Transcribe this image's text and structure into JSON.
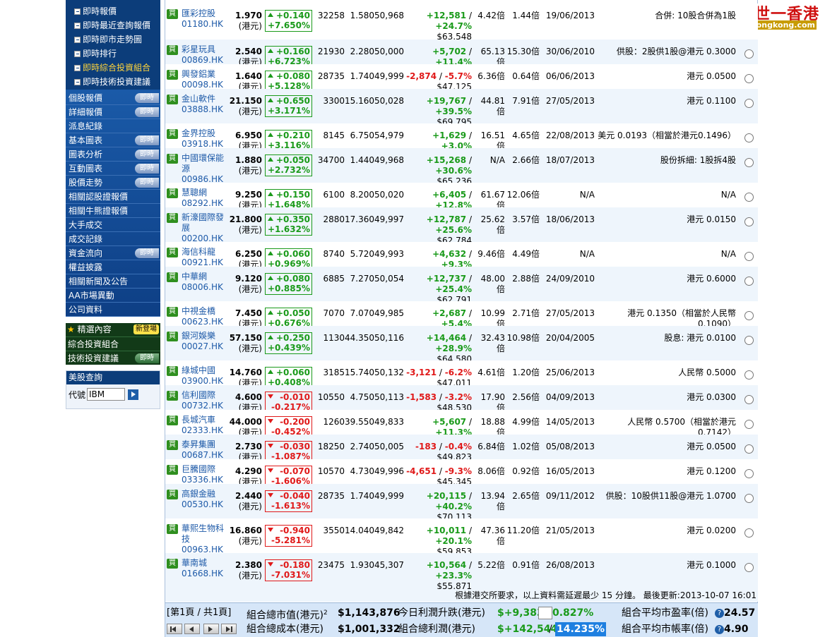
{
  "sidebar": {
    "sub_items": [
      "即時報價",
      "即時最近查詢報價",
      "即時即市走勢圖",
      "即時排行",
      "即時綜合投資組合",
      "即時技術投資建議"
    ],
    "menu_items": [
      {
        "label": "個股報價",
        "badge": "即時"
      },
      {
        "label": "詳細報價",
        "badge": "即時"
      },
      {
        "label": "派息紀錄",
        "badge": ""
      },
      {
        "label": "基本圖表",
        "badge": "即時"
      },
      {
        "label": "圖表分析",
        "badge": "即時"
      },
      {
        "label": "互動圖表",
        "badge": "即時"
      },
      {
        "label": "股價走勢",
        "badge": "即時"
      },
      {
        "label": "相關認股證報價",
        "badge": ""
      },
      {
        "label": "相關牛熊證報價",
        "badge": ""
      },
      {
        "label": "大手成交",
        "badge": ""
      },
      {
        "label": "成交記錄",
        "badge": ""
      },
      {
        "label": "資金流向",
        "badge": "即時"
      },
      {
        "label": "權益披露",
        "badge": ""
      },
      {
        "label": "相關新聞及公告",
        "badge": ""
      },
      {
        "label": "AA市場異動",
        "badge": ""
      },
      {
        "label": "公司資料",
        "badge": ""
      }
    ],
    "picks": {
      "title": "精選內容",
      "new_badge": "新登場",
      "row1": "綜合投資組合",
      "row2": "技術投資建議",
      "row2_badge": "即時"
    },
    "us": {
      "title": "美股查詢",
      "label": "代號",
      "value": "IBM"
    }
  },
  "logo": {
    "line1": "一世一香港",
    "line2": "141hongkong.com"
  },
  "rows": [
    {
      "buy": "買",
      "name": "匯彩控股",
      "code": "01180.HK",
      "price": "1.970",
      "unit": "(港元)",
      "dir": "up",
      "chg": "+0.140",
      "pct": "+7.650%",
      "qty": "32258",
      "cost": "1.580",
      "val": "50,968",
      "pl": "+12,581",
      "plpct": "+24.7%",
      "mv": "$63,548",
      "pe": "4.42倍",
      "pb": "1.44倍",
      "date": "19/06/2013",
      "note": "合併: 10股合併為1股",
      "radio": false
    },
    {
      "buy": "買",
      "name": "彩星玩具",
      "code": "00869.HK",
      "price": "2.540",
      "unit": "(港元)",
      "dir": "up",
      "chg": "+0.160",
      "pct": "+6.723%",
      "qty": "21930",
      "cost": "2.280",
      "val": "50,000",
      "pl": "+5,702",
      "plpct": "+11.4%",
      "mv": "$55,702",
      "pe": "65.13倍",
      "pb": "15.30倍",
      "date": "30/06/2010",
      "note": "供股：2股供1股@港元 0.3000",
      "radio": true
    },
    {
      "buy": "買",
      "name": "興發鋁業",
      "code": "00098.HK",
      "price": "1.640",
      "unit": "(港元)",
      "dir": "up",
      "chg": "+0.080",
      "pct": "+5.128%",
      "qty": "28735",
      "cost": "1.740",
      "val": "49,999",
      "pl": "-2,874",
      "plpct": "-5.7%",
      "mv": "$47,125",
      "pe": "6.36倍",
      "pb": "0.64倍",
      "date": "06/06/2013",
      "note": "港元 0.0500",
      "radio": true
    },
    {
      "buy": "買",
      "name": "金山軟件",
      "code": "03888.HK",
      "price": "21.150",
      "unit": "(港元)",
      "dir": "up",
      "chg": "+0.650",
      "pct": "+3.171%",
      "qty": "3300",
      "cost": "15.160",
      "val": "50,028",
      "pl": "+19,767",
      "plpct": "+39.5%",
      "mv": "$69,795",
      "pe": "44.81倍",
      "pb": "7.91倍",
      "date": "27/05/2013",
      "note": "港元 0.1100",
      "radio": true
    },
    {
      "buy": "買",
      "name": "金界控股",
      "code": "03918.HK",
      "price": "6.950",
      "unit": "(港元)",
      "dir": "up",
      "chg": "+0.210",
      "pct": "+3.116%",
      "qty": "8145",
      "cost": "6.750",
      "val": "54,979",
      "pl": "+1,629",
      "plpct": "+3.0%",
      "mv": "$56,608",
      "pe": "16.51倍",
      "pb": "4.65倍",
      "date": "22/08/2013",
      "note": "美元 0.0193（相當於港元0.1496）",
      "radio": true
    },
    {
      "buy": "買",
      "name": "中國環保能源",
      "code": "00986.HK",
      "price": "1.880",
      "unit": "(港元)",
      "dir": "up",
      "chg": "+0.050",
      "pct": "+2.732%",
      "qty": "34700",
      "cost": "1.440",
      "val": "49,968",
      "pl": "+15,268",
      "plpct": "+30.6%",
      "mv": "$65,236",
      "pe": "N/A",
      "pb": "2.66倍",
      "date": "18/07/2013",
      "note": "股份拆細: 1股拆4股",
      "radio": true
    },
    {
      "buy": "買",
      "name": "慧聰網",
      "code": "08292.HK",
      "price": "9.250",
      "unit": "(港元)",
      "dir": "up",
      "chg": "+0.150",
      "pct": "+1.648%",
      "qty": "6100",
      "cost": "8.200",
      "val": "50,020",
      "pl": "+6,405",
      "plpct": "+12.8%",
      "mv": "$56,425",
      "pe": "61.67倍",
      "pb": "12.06倍",
      "date": "N/A",
      "note": "N/A",
      "radio": true
    },
    {
      "buy": "買",
      "name": "新濠國際發展",
      "code": "00200.HK",
      "price": "21.800",
      "unit": "(港元)",
      "dir": "up",
      "chg": "+0.350",
      "pct": "+1.632%",
      "qty": "2880",
      "cost": "17.360",
      "val": "49,997",
      "pl": "+12,787",
      "plpct": "+25.6%",
      "mv": "$62,784",
      "pe": "25.62倍",
      "pb": "3.57倍",
      "date": "18/06/2013",
      "note": "港元 0.0150",
      "radio": true
    },
    {
      "buy": "買",
      "name": "海信科龍",
      "code": "00921.HK",
      "price": "6.250",
      "unit": "(港元)",
      "dir": "up",
      "chg": "+0.060",
      "pct": "+0.969%",
      "qty": "8740",
      "cost": "5.720",
      "val": "49,993",
      "pl": "+4,632",
      "plpct": "+9.3%",
      "mv": "$54,625",
      "pe": "9.46倍",
      "pb": "4.49倍",
      "date": "N/A",
      "note": "N/A",
      "radio": true
    },
    {
      "buy": "買",
      "name": "中華網",
      "code": "08006.HK",
      "price": "9.120",
      "unit": "(港元)",
      "dir": "up",
      "chg": "+0.080",
      "pct": "+0.885%",
      "qty": "6885",
      "cost": "7.270",
      "val": "50,054",
      "pl": "+12,737",
      "plpct": "+25.4%",
      "mv": "$62,791",
      "pe": "48.00倍",
      "pb": "2.88倍",
      "date": "24/09/2010",
      "note": "港元 0.6000",
      "radio": true
    },
    {
      "buy": "買",
      "name": "中視金橋",
      "code": "00623.HK",
      "price": "7.450",
      "unit": "(港元)",
      "dir": "up",
      "chg": "+0.050",
      "pct": "+0.676%",
      "qty": "7070",
      "cost": "7.070",
      "val": "49,985",
      "pl": "+2,687",
      "plpct": "+5.4%",
      "mv": "$52,672",
      "pe": "10.99倍",
      "pb": "2.71倍",
      "date": "27/05/2013",
      "note": "港元 0.1350（相當於人民幣 0.1090）",
      "radio": true
    },
    {
      "buy": "買",
      "name": "銀河娛樂",
      "code": "00027.HK",
      "price": "57.150",
      "unit": "(港元)",
      "dir": "up",
      "chg": "+0.250",
      "pct": "+0.439%",
      "qty": "1130",
      "cost": "44.350",
      "val": "50,116",
      "pl": "+14,464",
      "plpct": "+28.9%",
      "mv": "$64,580",
      "pe": "32.43倍",
      "pb": "10.98倍",
      "date": "20/04/2005",
      "note": "股息: 港元 0.0100",
      "radio": true
    },
    {
      "buy": "買",
      "name": "綠城中國",
      "code": "03900.HK",
      "price": "14.760",
      "unit": "(港元)",
      "dir": "up",
      "chg": "+0.060",
      "pct": "+0.408%",
      "qty": "3185",
      "cost": "15.740",
      "val": "50,132",
      "pl": "-3,121",
      "plpct": "-6.2%",
      "mv": "$47,011",
      "pe": "4.61倍",
      "pb": "1.20倍",
      "date": "25/06/2013",
      "note": "人民幣 0.5000",
      "radio": true
    },
    {
      "buy": "買",
      "name": "信利國際",
      "code": "00732.HK",
      "price": "4.600",
      "unit": "(港元)",
      "dir": "down",
      "chg": "-0.010",
      "pct": "-0.217%",
      "qty": "10550",
      "cost": "4.750",
      "val": "50,113",
      "pl": "-1,583",
      "plpct": "-3.2%",
      "mv": "$48,530",
      "pe": "17.90倍",
      "pb": "2.56倍",
      "date": "04/09/2013",
      "note": "港元 0.0300",
      "radio": true
    },
    {
      "buy": "買",
      "name": "長城汽車",
      "code": "02333.HK",
      "price": "44.000",
      "unit": "(港元)",
      "dir": "down",
      "chg": "-0.200",
      "pct": "-0.452%",
      "qty": "1260",
      "cost": "39.550",
      "val": "49,833",
      "pl": "+5,607",
      "plpct": "+11.3%",
      "mv": "$55,440",
      "pe": "18.88倍",
      "pb": "4.99倍",
      "date": "14/05/2013",
      "note": "人民幣 0.5700（相當於港元 0.7142）",
      "radio": true
    },
    {
      "buy": "買",
      "name": "泰昇集團",
      "code": "00687.HK",
      "price": "2.730",
      "unit": "(港元)",
      "dir": "down",
      "chg": "-0.030",
      "pct": "-1.087%",
      "qty": "18250",
      "cost": "2.740",
      "val": "50,005",
      "pl": "-183",
      "plpct": "-0.4%",
      "mv": "$49,823",
      "pe": "6.84倍",
      "pb": "1.02倍",
      "date": "05/08/2013",
      "note": "港元 0.0500",
      "radio": true
    },
    {
      "buy": "買",
      "name": "巨騰國際",
      "code": "03336.HK",
      "price": "4.290",
      "unit": "(港元)",
      "dir": "down",
      "chg": "-0.070",
      "pct": "-1.606%",
      "qty": "10570",
      "cost": "4.730",
      "val": "49,996",
      "pl": "-4,651",
      "plpct": "-9.3%",
      "mv": "$45,345",
      "pe": "8.06倍",
      "pb": "0.92倍",
      "date": "16/05/2013",
      "note": "港元 0.1200",
      "radio": true
    },
    {
      "buy": "買",
      "name": "高銀金融",
      "code": "00530.HK",
      "price": "2.440",
      "unit": "(港元)",
      "dir": "down",
      "chg": "-0.040",
      "pct": "-1.613%",
      "qty": "28735",
      "cost": "1.740",
      "val": "49,999",
      "pl": "+20,115",
      "plpct": "+40.2%",
      "mv": "$70,113",
      "pe": "13.94倍",
      "pb": "2.65倍",
      "date": "09/11/2012",
      "note": "供股：10股供11股@港元 1.0700",
      "radio": true
    },
    {
      "buy": "買",
      "name": "華熙生物科技",
      "code": "00963.HK",
      "price": "16.860",
      "unit": "(港元)",
      "dir": "down",
      "chg": "-0.940",
      "pct": "-5.281%",
      "qty": "3550",
      "cost": "14.040",
      "val": "49,842",
      "pl": "+10,011",
      "plpct": "+20.1%",
      "mv": "$59,853",
      "pe": "47.36倍",
      "pb": "11.20倍",
      "date": "21/05/2013",
      "note": "港元 0.0200",
      "radio": true
    },
    {
      "buy": "買",
      "name": "華南城",
      "code": "01668.HK",
      "price": "2.380",
      "unit": "(港元)",
      "dir": "down",
      "chg": "-0.180",
      "pct": "-7.031%",
      "qty": "23475",
      "cost": "1.930",
      "val": "45,307",
      "pl": "+10,564",
      "plpct": "+23.3%",
      "mv": "$55,871",
      "pe": "5.22倍",
      "pb": "0.91倍",
      "date": "26/08/2013",
      "note": "港元 0.1000",
      "radio": true
    }
  ],
  "footnote": "根據港交所要求，以上資料需延遲最少 15 分鐘。 最後更新:2013-10-07 16:01",
  "summary": {
    "page": "[第1頁 / 共1頁]",
    "mv_label": "組合總市值(港元)",
    "mv_sup": "2",
    "mv_value": "$1,143,876",
    "cost_label": "組合總成本(港元)",
    "cost_value": "$1,001,332",
    "today_label": "今日利潤升跌(港元)",
    "today_value": "$+9,383",
    "today_pct": "0.827%",
    "total_label": "組合總利潤(港元)",
    "total_value": "$+142,544",
    "total_sep": "/",
    "total_pct": "14.235%",
    "pe_label": "組合平均市盈率(倍)",
    "pe_value": "24.57",
    "pb_label": "組合平均市帳率(倍)",
    "pb_value": "4.90",
    "help": "?"
  }
}
